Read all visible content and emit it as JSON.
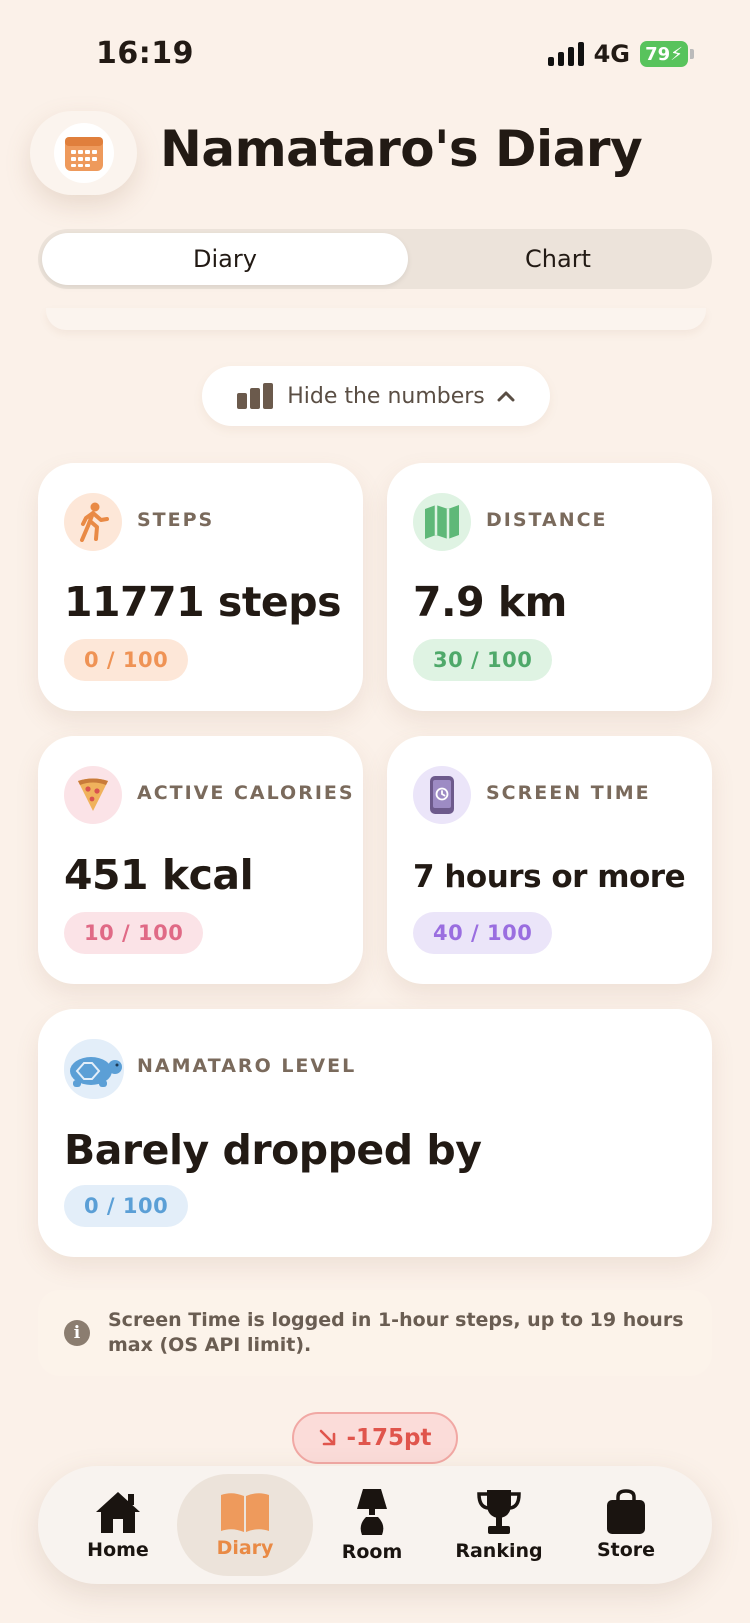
{
  "status_bar": {
    "time": "16:19",
    "network": "4G",
    "battery": "79"
  },
  "header": {
    "title": "Namataro's Diary",
    "icon": "calendar-icon"
  },
  "tabs": [
    {
      "label": "Diary",
      "active": true
    },
    {
      "label": "Chart",
      "active": false
    }
  ],
  "hide_toggle": {
    "label": "Hide the numbers",
    "icon": "bar-chart-icon",
    "chevron": "chevron-up-icon"
  },
  "cards": {
    "steps": {
      "label": "STEPS",
      "value": "11771 steps",
      "score": "0 / 100",
      "icon": "walking-icon",
      "accent": "#e98a45"
    },
    "distance": {
      "label": "DISTANCE",
      "value": "7.9 km",
      "score": "30 / 100",
      "icon": "map-icon",
      "accent": "#4fa96a"
    },
    "calories": {
      "label": "ACTIVE CALORIES",
      "value": "451 kcal",
      "score": "10 / 100",
      "icon": "pizza-icon",
      "accent": "#e06a86"
    },
    "screen_time": {
      "label": "SCREEN TIME",
      "value": "7 hours or more",
      "score": "40 / 100",
      "icon": "phone-icon",
      "accent": "#9a6ee0"
    },
    "level": {
      "label": "NAMATARO LEVEL",
      "value": "Barely dropped by",
      "score": "0 / 100",
      "icon": "turtle-icon",
      "accent": "#5b9fd6"
    }
  },
  "info_note": {
    "text": "Screen Time is logged in 1-hour steps, up to 19 hours max (OS API limit).",
    "icon": "info-icon"
  },
  "points": {
    "value": "-175pt",
    "icon": "arrow-down-right-icon",
    "color": "#e0554c"
  },
  "tab_bar": {
    "items": [
      {
        "label": "Home",
        "icon": "home-icon",
        "active": false
      },
      {
        "label": "Diary",
        "icon": "book-icon",
        "active": true
      },
      {
        "label": "Room",
        "icon": "lamp-icon",
        "active": false
      },
      {
        "label": "Ranking",
        "icon": "trophy-icon",
        "active": false
      },
      {
        "label": "Store",
        "icon": "bag-icon",
        "active": false
      }
    ]
  }
}
